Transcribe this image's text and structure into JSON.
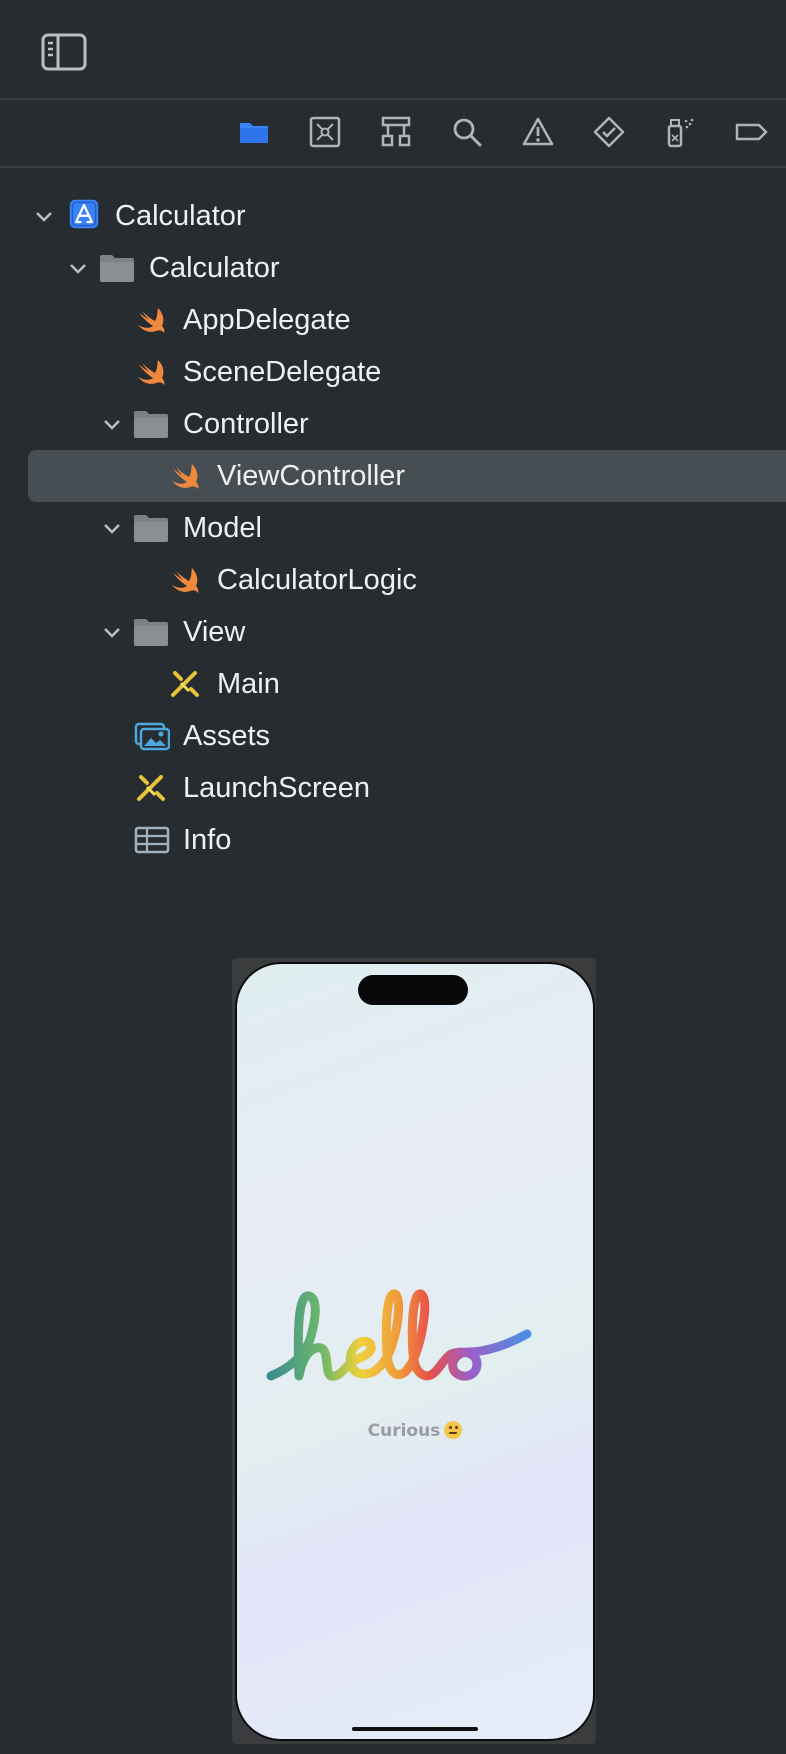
{
  "toolbar": {
    "sidebar_toggle_icon": "sidebar-left-icon"
  },
  "navigator_tabs": [
    {
      "name": "project",
      "icon": "folder-icon",
      "active": true
    },
    {
      "name": "source-control",
      "icon": "source-control-icon",
      "active": false
    },
    {
      "name": "symbols",
      "icon": "hierarchy-icon",
      "active": false
    },
    {
      "name": "find",
      "icon": "magnifier-icon",
      "active": false
    },
    {
      "name": "issues",
      "icon": "warning-icon",
      "active": false
    },
    {
      "name": "tests",
      "icon": "diamond-check-icon",
      "active": false
    },
    {
      "name": "debug",
      "icon": "spray-icon",
      "active": false
    },
    {
      "name": "breakpoints",
      "icon": "breakpoint-icon",
      "active": false
    }
  ],
  "tree": [
    {
      "label": "Calculator",
      "type": "project",
      "expanded": true
    },
    {
      "label": "Calculator",
      "type": "folder",
      "expanded": true
    },
    {
      "label": "AppDelegate",
      "type": "swift"
    },
    {
      "label": "SceneDelegate",
      "type": "swift"
    },
    {
      "label": "Controller",
      "type": "folder",
      "expanded": true
    },
    {
      "label": "ViewController",
      "type": "swift",
      "selected": true
    },
    {
      "label": "Model",
      "type": "folder",
      "expanded": true
    },
    {
      "label": "CalculatorLogic",
      "type": "swift"
    },
    {
      "label": "View",
      "type": "folder",
      "expanded": true
    },
    {
      "label": "Main",
      "type": "storyboard"
    },
    {
      "label": "Assets",
      "type": "assets"
    },
    {
      "label": "LaunchScreen",
      "type": "storyboard"
    },
    {
      "label": "Info",
      "type": "plist"
    }
  ],
  "preview": {
    "hello_text": "hello",
    "subtitle": "Curious",
    "subtitle_emoji": "smiling-face-icon"
  },
  "colors": {
    "background": "#262c30",
    "selection": "#474e53",
    "accent": "#3a82f7",
    "swift": "#f0883e"
  }
}
